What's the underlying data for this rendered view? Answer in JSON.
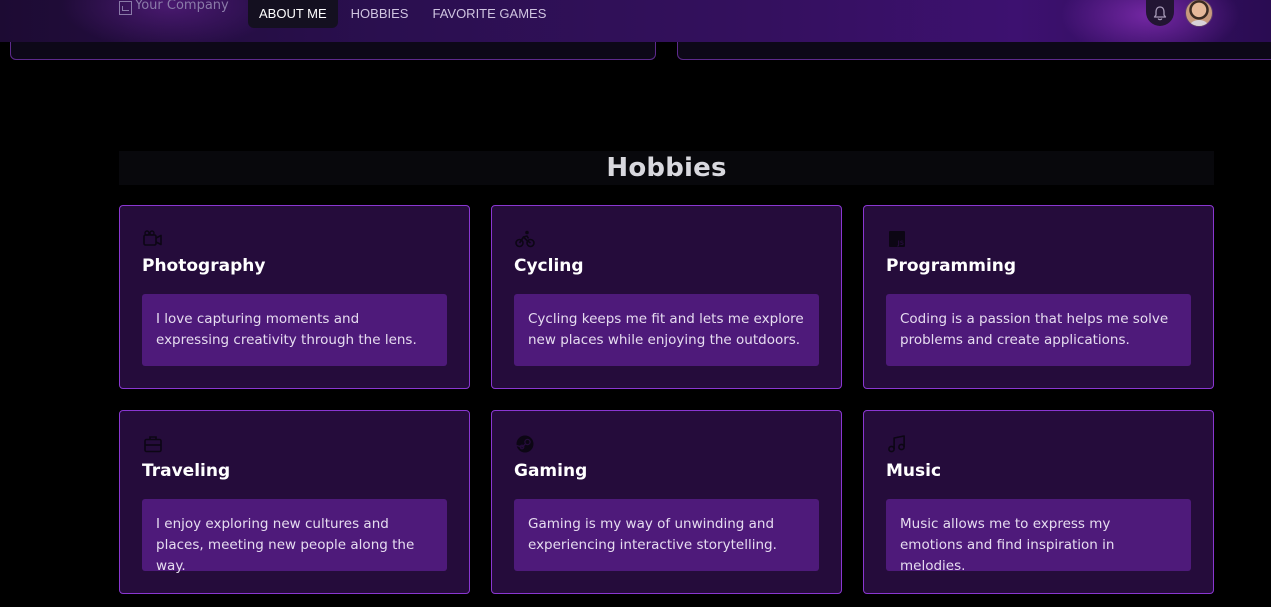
{
  "header": {
    "logo_alt": "Your Company",
    "nav": [
      {
        "label": "ABOUT ME",
        "active": true
      },
      {
        "label": "HOBBIES",
        "active": false
      },
      {
        "label": "FAVORITE GAMES",
        "active": false
      }
    ],
    "bell_icon": "bell-icon",
    "avatar": "user-avatar"
  },
  "hobbies": {
    "title": "Hobbies",
    "items": [
      {
        "icon": "video-camera-icon",
        "title": "Photography",
        "description": "I love capturing moments and expressing creativity through the lens."
      },
      {
        "icon": "bicycle-icon",
        "title": "Cycling",
        "description": "Cycling keeps me fit and lets me explore new places while enjoying the outdoors."
      },
      {
        "icon": "javascript-icon",
        "title": "Programming",
        "description": "Coding is a passion that helps me solve problems and create applications."
      },
      {
        "icon": "suitcase-icon",
        "title": "Traveling",
        "description": "I enjoy exploring new cultures and places, meeting new people along the way."
      },
      {
        "icon": "steam-icon",
        "title": "Gaming",
        "description": "Gaming is my way of unwinding and experiencing interactive storytelling."
      },
      {
        "icon": "music-note-icon",
        "title": "Music",
        "description": "Music allows me to express my emotions and find inspiration in melodies."
      }
    ]
  },
  "colors": {
    "background": "#000000",
    "card": "#250c3b",
    "card_border": "#8a37d1",
    "desc_box": "#4e1a7a",
    "nav_gradient_end": "#3d1170"
  }
}
